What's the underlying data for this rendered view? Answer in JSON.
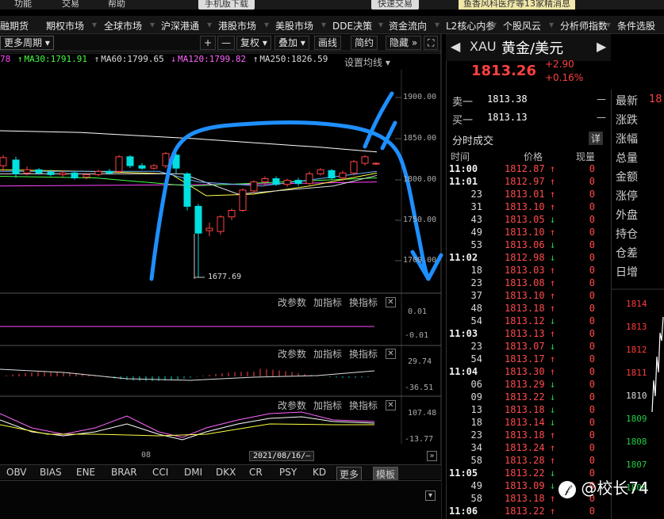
{
  "topbar": {
    "items": [
      "功能",
      "交易",
      "帮助"
    ],
    "mobile_download": "手机版下载",
    "fast_trade": "快速交易",
    "news": "鱼香风科医疗等13家精消息"
  },
  "menu": {
    "items": [
      "融期货",
      "期权市场",
      "全球市场",
      "沪深港通",
      "港股市场",
      "美股市场",
      "DDE决策",
      "资金流向",
      "L2核心内参",
      "个股风云",
      "分析师指数",
      "条件选股"
    ]
  },
  "toolbar": {
    "period": "更多周期",
    "plus": "+",
    "minus": "—",
    "restore": "复权",
    "overlay": "叠加",
    "draw": "画线",
    "simple": "简约",
    "hide": "隐藏",
    "expand_icon": "expand-icon"
  },
  "ma_legend": {
    "ma_partial": "78",
    "ma30": "MA30:1791.91",
    "ma60": "MA60:1799.65",
    "ma120": "MA120:1799.82",
    "ma250": "MA250:1826.59",
    "setting": "设置均线",
    "colors": {
      "ma_partial": "#ff44ff",
      "ma30": "#44ff44",
      "ma60": "#ffffff",
      "ma120": "#ff44ff",
      "ma250": "#ffffff"
    }
  },
  "price_axis": [
    "1900.00",
    "1850.00",
    "1800.00",
    "1750.00",
    "1700.00"
  ],
  "low_label": "1677.69",
  "subcharts": [
    {
      "modify": "改参数",
      "add": "加指标",
      "switch": "换指标",
      "close": "✕",
      "values": [
        "0.01",
        "-0.01"
      ]
    },
    {
      "modify": "改参数",
      "add": "加指标",
      "switch": "换指标",
      "close": "✕",
      "values": [
        "29.74",
        "-36.51"
      ]
    },
    {
      "modify": "改参数",
      "add": "加指标",
      "switch": "换指标",
      "close": "✕",
      "values": [
        "107.48",
        "-13.77"
      ]
    }
  ],
  "date_axis": {
    "month": "08",
    "cursor_date": "2021/08/16/—"
  },
  "indicator_tabs": [
    "OBV",
    "BIAS",
    "ENE",
    "BRAR",
    "CCI",
    "DMI",
    "DKX",
    "CR",
    "PSY",
    "KD"
  ],
  "indicator_more": "更多",
  "indicator_template": "模板",
  "quote": {
    "symbol": "XAU",
    "name": "黄金/美元",
    "price": "1813.26",
    "change": "+2.90",
    "change_pct": "+0.16%",
    "sell_label": "卖一",
    "sell_price": "1813.38",
    "sell_vol": "—",
    "buy_label": "买一",
    "buy_price": "1813.13",
    "buy_vol": "—",
    "ticks_title": "分时成交",
    "detail": "详",
    "col_time": "时间",
    "col_price": "价格",
    "col_vol": "现量"
  },
  "trades": [
    {
      "time": "11:00",
      "major": true,
      "price": "1812.87",
      "dir": "up",
      "vol": "0"
    },
    {
      "time": "11:01",
      "major": true,
      "price": "1812.97",
      "dir": "up",
      "vol": "0"
    },
    {
      "time": "23",
      "major": false,
      "price": "1813.01",
      "dir": "up",
      "vol": "0"
    },
    {
      "time": "31",
      "major": false,
      "price": "1813.10",
      "dir": "up",
      "vol": "0"
    },
    {
      "time": "43",
      "major": false,
      "price": "1813.05",
      "dir": "down",
      "vol": "0"
    },
    {
      "time": "49",
      "major": false,
      "price": "1813.10",
      "dir": "up",
      "vol": "0"
    },
    {
      "time": "53",
      "major": false,
      "price": "1813.06",
      "dir": "down",
      "vol": "0"
    },
    {
      "time": "11:02",
      "major": true,
      "price": "1812.98",
      "dir": "down",
      "vol": "0"
    },
    {
      "time": "18",
      "major": false,
      "price": "1813.03",
      "dir": "up",
      "vol": "0"
    },
    {
      "time": "23",
      "major": false,
      "price": "1813.08",
      "dir": "up",
      "vol": "0"
    },
    {
      "time": "37",
      "major": false,
      "price": "1813.10",
      "dir": "up",
      "vol": "0"
    },
    {
      "time": "48",
      "major": false,
      "price": "1813.18",
      "dir": "up",
      "vol": "0"
    },
    {
      "time": "54",
      "major": false,
      "price": "1813.12",
      "dir": "down",
      "vol": "0"
    },
    {
      "time": "11:03",
      "major": true,
      "price": "1813.13",
      "dir": "up",
      "vol": "0"
    },
    {
      "time": "23",
      "major": false,
      "price": "1813.07",
      "dir": "down",
      "vol": "0"
    },
    {
      "time": "54",
      "major": false,
      "price": "1813.17",
      "dir": "up",
      "vol": "0"
    },
    {
      "time": "11:04",
      "major": true,
      "price": "1813.30",
      "dir": "up",
      "vol": "0"
    },
    {
      "time": "06",
      "major": false,
      "price": "1813.29",
      "dir": "down",
      "vol": "0"
    },
    {
      "time": "09",
      "major": false,
      "price": "1813.22",
      "dir": "down",
      "vol": "0"
    },
    {
      "time": "13",
      "major": false,
      "price": "1813.18",
      "dir": "down",
      "vol": "0"
    },
    {
      "time": "18",
      "major": false,
      "price": "1813.14",
      "dir": "down",
      "vol": "0"
    },
    {
      "time": "23",
      "major": false,
      "price": "1813.18",
      "dir": "up",
      "vol": "0"
    },
    {
      "time": "34",
      "major": false,
      "price": "1813.24",
      "dir": "up",
      "vol": "0"
    },
    {
      "time": "58",
      "major": false,
      "price": "1813.28",
      "dir": "up",
      "vol": "0"
    },
    {
      "time": "11:05",
      "major": true,
      "price": "1813.22",
      "dir": "down",
      "vol": "0"
    },
    {
      "time": "49",
      "major": false,
      "price": "1813.09",
      "dir": "down",
      "vol": "0"
    },
    {
      "time": "58",
      "major": false,
      "price": "1813.18",
      "dir": "up",
      "vol": "0"
    },
    {
      "time": "11:06",
      "major": true,
      "price": "1813.22",
      "dir": "up",
      "vol": "0"
    }
  ],
  "stats": [
    "最新",
    "涨跌",
    "涨幅",
    "总量",
    "金额",
    "涨停",
    "外盘",
    "持仓",
    "仓差",
    "日增"
  ],
  "stats_partial_value": "18",
  "intraday_ticks": [
    "1814",
    "1813",
    "1812",
    "1811",
    "1810",
    "1809",
    "1808",
    "1807",
    "1806"
  ],
  "watermark": "@校长74",
  "colors": {
    "up": "#ff3c3c",
    "down": "#22cc44",
    "accent_blue": "#1e8fff"
  }
}
